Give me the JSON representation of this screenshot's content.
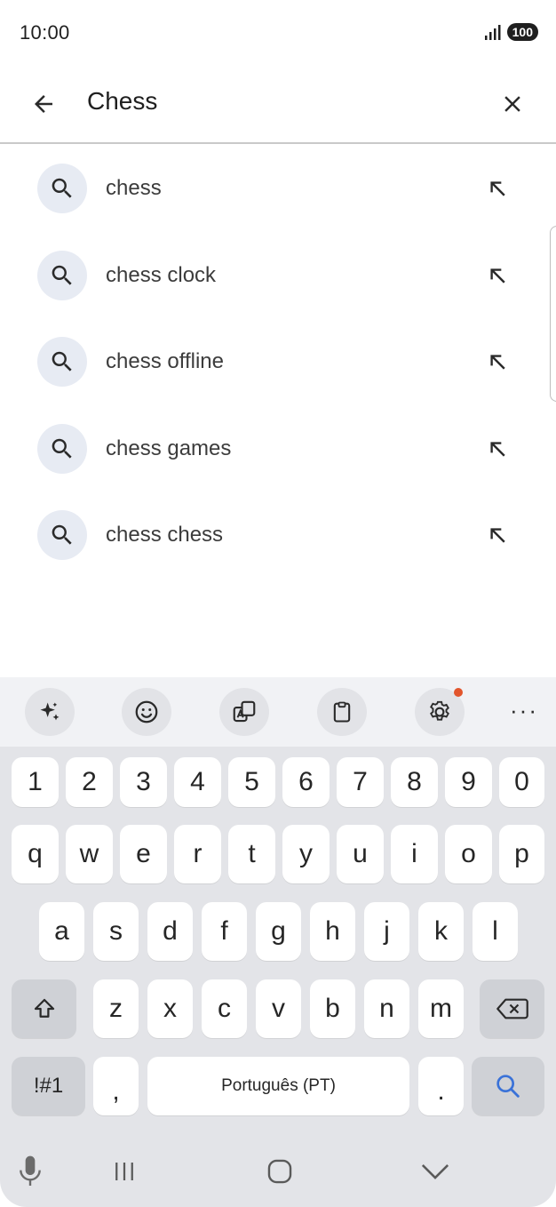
{
  "status": {
    "time": "10:00",
    "battery": "100",
    "icons": [
      "signal-icon",
      "battery-icon"
    ]
  },
  "search": {
    "query": "Chess",
    "back_icon": "arrow-back-icon",
    "clear_icon": "close-icon"
  },
  "suggestions": [
    {
      "label": "chess",
      "icon": "search-icon",
      "action_icon": "arrow-up-left-icon"
    },
    {
      "label": "chess clock",
      "icon": "search-icon",
      "action_icon": "arrow-up-left-icon"
    },
    {
      "label": "chess offline",
      "icon": "search-icon",
      "action_icon": "arrow-up-left-icon"
    },
    {
      "label": "chess games",
      "icon": "search-icon",
      "action_icon": "arrow-up-left-icon"
    },
    {
      "label": "chess chess",
      "icon": "search-icon",
      "action_icon": "arrow-up-left-icon"
    }
  ],
  "keyboard": {
    "toolbar": [
      "sparkle-icon",
      "emoji-icon",
      "translate-icon",
      "clipboard-icon",
      "settings-icon",
      "more-icon"
    ],
    "more_label": "···",
    "row_numbers": [
      "1",
      "2",
      "3",
      "4",
      "5",
      "6",
      "7",
      "8",
      "9",
      "0"
    ],
    "row1": [
      "q",
      "w",
      "e",
      "r",
      "t",
      "y",
      "u",
      "i",
      "o",
      "p"
    ],
    "row2": [
      "a",
      "s",
      "d",
      "f",
      "g",
      "h",
      "j",
      "k",
      "l"
    ],
    "row3": [
      "z",
      "x",
      "c",
      "v",
      "b",
      "n",
      "m"
    ],
    "symbols_label": "!#1",
    "comma_label": ",",
    "space_label": "Português (PT)",
    "period_label": ".",
    "accent_color": "#3a72d8"
  },
  "navbar": {
    "icons": [
      "microphone-icon",
      "recent-apps-icon",
      "home-icon",
      "hide-keyboard-icon"
    ]
  }
}
